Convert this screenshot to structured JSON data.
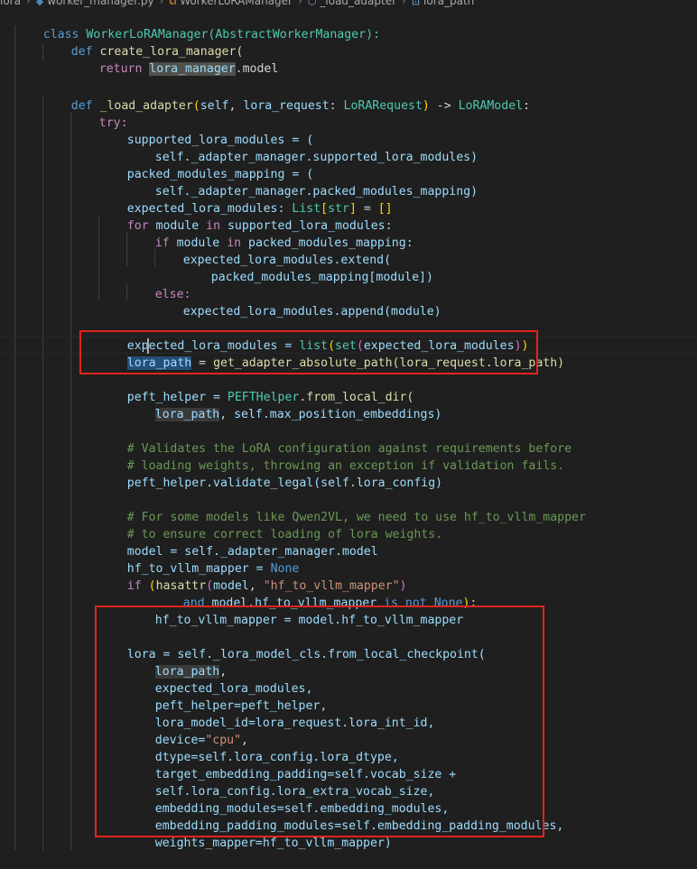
{
  "breadcrumb": {
    "items": [
      "lora",
      "worker_manager.py",
      "WorkerLoRAManager",
      "_load_adapter",
      "lora_path"
    ]
  },
  "code": {
    "l_class": "WorkerLoRAManager(AbstractWorkerManager):",
    "l_create": "create_lora_manager(",
    "l_return_model": ".model",
    "l_load_sig_params": "(self, lora_request: ",
    "l_load_sig_type": "LoRARequest",
    "l_load_sig_ret": "LoRAModel",
    "supported_1": "supported_lora_modules = (",
    "supported_2": "self._adapter_manager.supported_lora_modules)",
    "packed_1": "packed_modules_mapping = (",
    "packed_2": "self._adapter_manager.packed_modules_mapping)",
    "expected_decl": "expected_lora_modules: ",
    "for_line": "module ",
    "for_line2": " supported_lora_modules:",
    "if_line": "module ",
    "if_line2": " packed_modules_mapping:",
    "extend": "expected_lora_modules.extend(",
    "packed_idx": "packed_modules_mapping[module])",
    "append": "expected_lora_modules.append(module)",
    "expected_list": "expected_lora_modules = ",
    "lora_path_assign": "get_adapter_absolute_path(lora_request.lora_path)",
    "peft_1": "peft_helper = ",
    "peft_1b": "PEFTHelper",
    "peft_1c": ".from_local_dir(",
    "peft_2": ", self.max_position_embeddings)",
    "cmt_1": "# Validates the LoRA configuration against requirements before",
    "cmt_2": "# loading weights, throwing an exception if validation fails.",
    "validate": "peft_helper.validate_legal(self.lora_config)",
    "cmt_3": "# For some models like Qwen2VL, we need to use hf_to_vllm_mapper",
    "cmt_4": "# to ensure correct loading of lora weights.",
    "model_assign": "model = self._adapter_manager.model",
    "hf_none": "hf_to_vllm_mapper = ",
    "if_hasattr_a": "hasattr",
    "if_hasattr_b": "(model, ",
    "if_hasattr_str": "\"hf_to_vllm_mapper\"",
    "and_line": " model.hf_to_vllm_mapper ",
    "hf_assign": "hf_to_vllm_mapper = model.hf_to_vllm_mapper",
    "lora_call": "lora = self._lora_model_cls.from_local_checkpoint(",
    "arg_lora_path": "lora_path",
    "arg_expected": "expected_lora_modules,",
    "arg_peft": "peft_helper=peft_helper,",
    "arg_model_id": "lora_model_id=lora_request.lora_int_id,",
    "arg_device_a": "device=",
    "arg_device_str": "\"cpu\"",
    "arg_dtype": "dtype=self.lora_config.lora_dtype,",
    "arg_target": "target_embedding_padding=self.vocab_size +",
    "arg_extra": "self.lora_config.lora_extra_vocab_size,",
    "arg_embed": "embedding_modules=self.embedding_modules,",
    "arg_embed_pad": "embedding_padding_modules=self.embedding_padding_modules,",
    "arg_weights": "weights_mapper=hf_to_vllm_mapper)"
  },
  "keywords": {
    "class": "class",
    "def": "def",
    "return": "return",
    "try": "try:",
    "for": "for",
    "in": "in",
    "if": "if",
    "else": "else:",
    "and": "and",
    "is_not": "is not",
    "none": "None",
    "list": "list",
    "set": "set",
    "List": "List",
    "str": "str"
  },
  "names": {
    "lora_manager": "lora_manager",
    "load_adapter": "_load_adapter",
    "lora_path": "lora_path"
  },
  "colors": {
    "highlight_box": "#e0251c",
    "background": "#1f1f1f"
  }
}
